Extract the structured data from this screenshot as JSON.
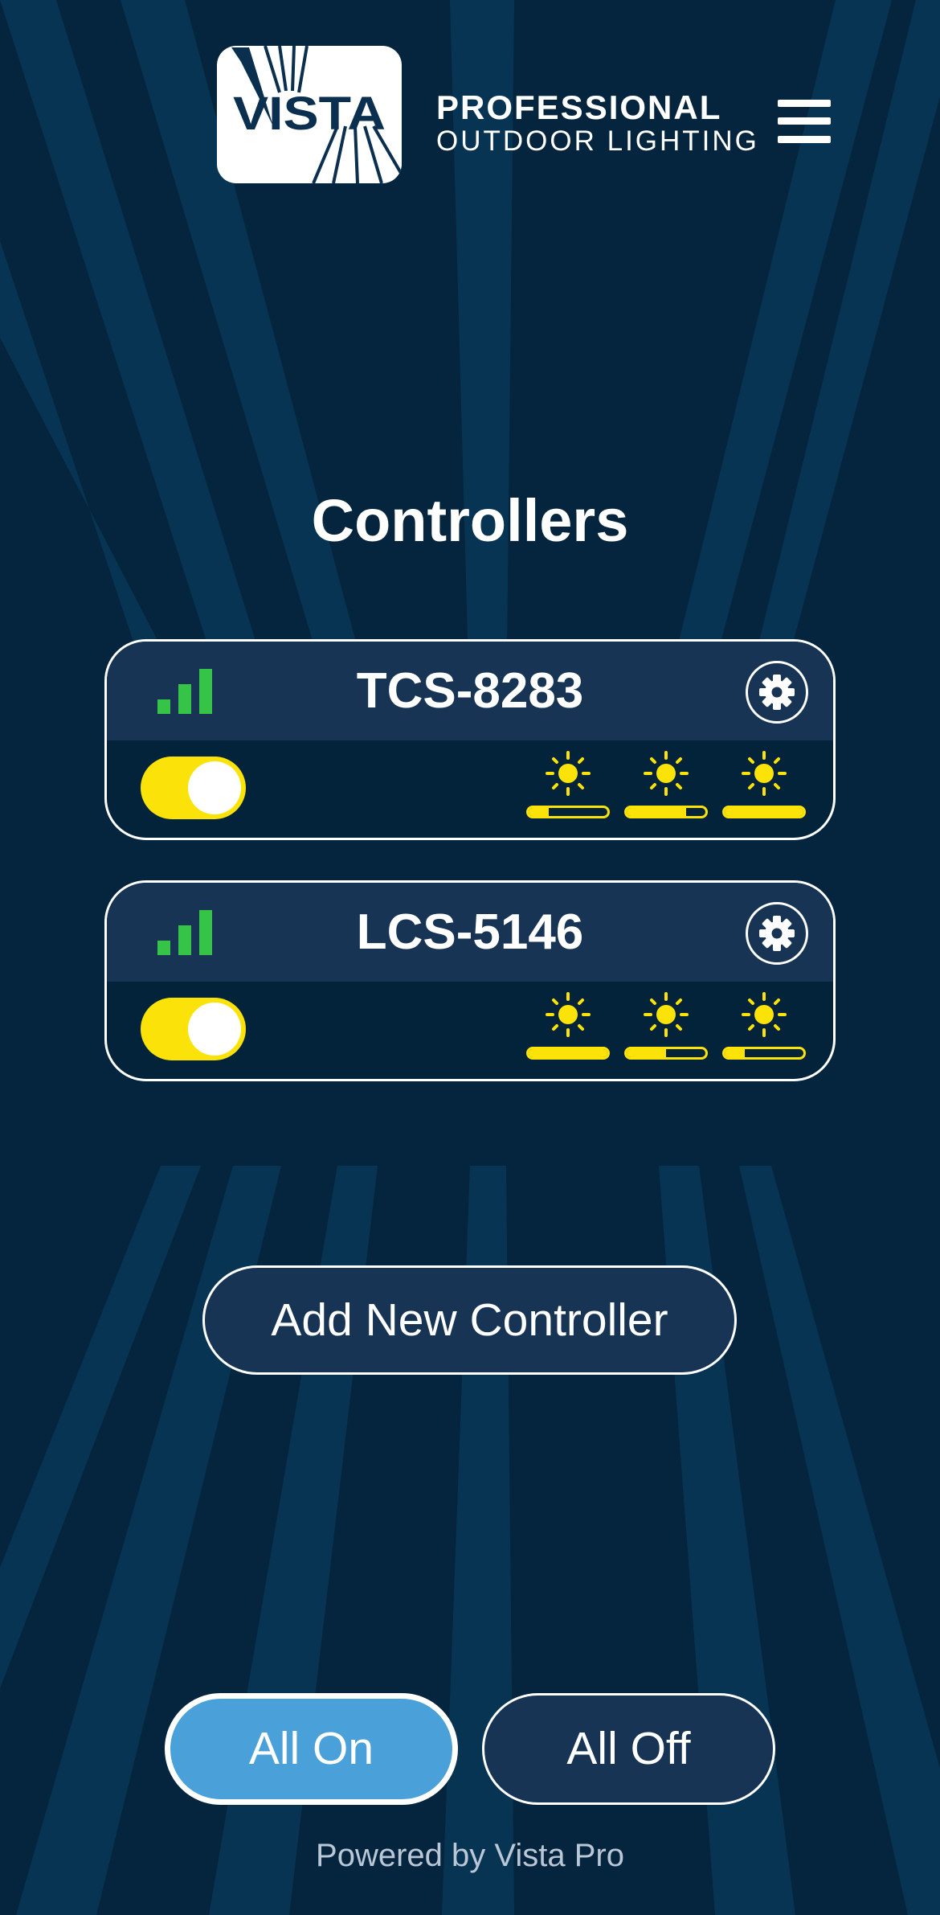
{
  "brand": {
    "logo_text": "VISTA",
    "line1": "PROFESSIONAL",
    "line2": "OUTDOOR LIGHTING"
  },
  "header": {
    "menu_icon": "hamburger-menu-icon"
  },
  "page_title": "Controllers",
  "colors": {
    "background": "#04253d",
    "card_header": "#173455",
    "accent_yellow": "#fbe30a",
    "signal_green": "#35c447",
    "all_on_blue": "#4aa0d8"
  },
  "controllers": [
    {
      "name": "TCS-8283",
      "signal_icon": "signal-strength-icon",
      "settings_icon": "gear-icon",
      "power_on": true,
      "zones": [
        {
          "icon": "sun-icon",
          "level": 0.25
        },
        {
          "icon": "sun-icon",
          "level": 0.75
        },
        {
          "icon": "sun-icon",
          "level": 1.0
        }
      ]
    },
    {
      "name": "LCS-5146",
      "signal_icon": "signal-strength-icon",
      "settings_icon": "gear-icon",
      "power_on": true,
      "zones": [
        {
          "icon": "sun-icon",
          "level": 1.0
        },
        {
          "icon": "sun-icon",
          "level": 0.5
        },
        {
          "icon": "sun-icon",
          "level": 0.25
        }
      ]
    }
  ],
  "actions": {
    "add_controller": "Add New Controller",
    "all_on": "All On",
    "all_off": "All Off"
  },
  "footer": "Powered by Vista Pro"
}
